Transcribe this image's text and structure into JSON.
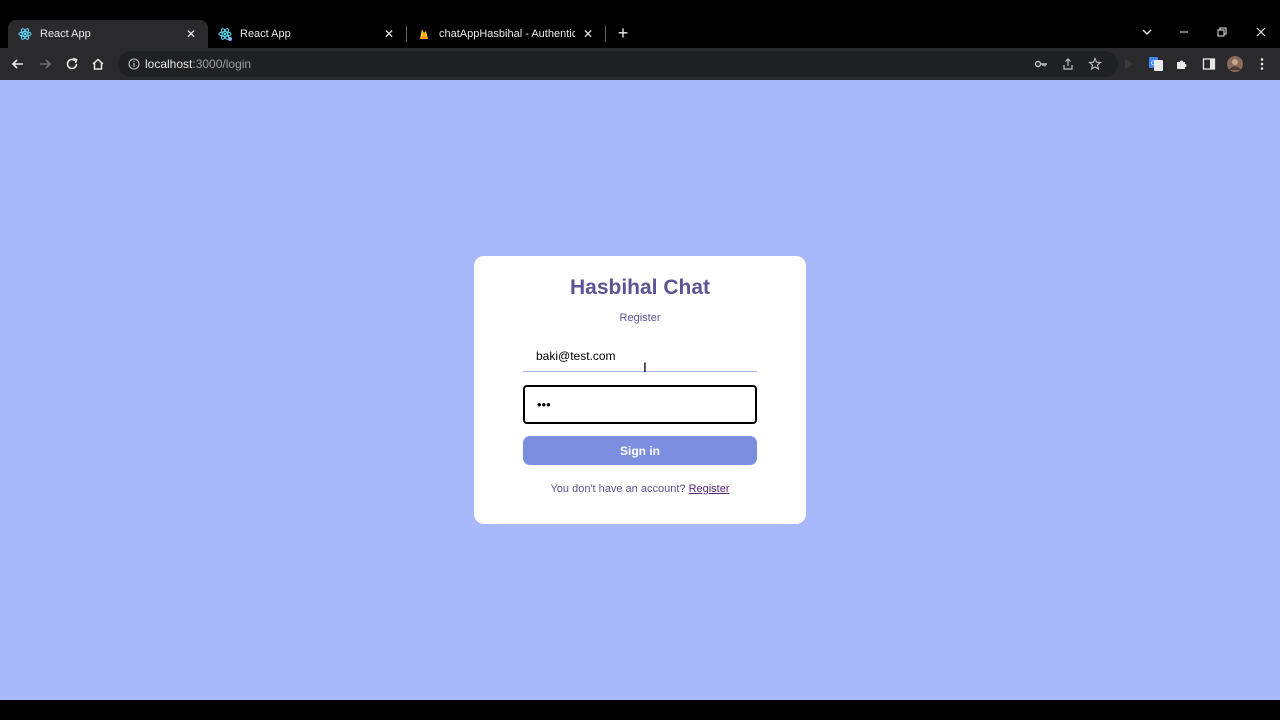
{
  "browser": {
    "tabs": [
      {
        "title": "React App",
        "favicon": "react-icon",
        "active": true
      },
      {
        "title": "React App",
        "favicon": "react-icon",
        "active": false
      },
      {
        "title": "chatAppHasbihal - Authenticatio",
        "favicon": "firebase-icon",
        "active": false
      }
    ],
    "url_host": "localhost",
    "url_path": ":3000/login"
  },
  "login": {
    "logo": "Hasbihal Chat",
    "subtitle": "Register",
    "email_value": "baki@test.com",
    "password_value": "•••",
    "signin_label": "Sign in",
    "footer_text": "You don't have an account? ",
    "footer_link": "Register"
  },
  "colors": {
    "page_bg": "#a7b8fb",
    "accent": "#7b8ee0",
    "logo": "#5a5593"
  }
}
